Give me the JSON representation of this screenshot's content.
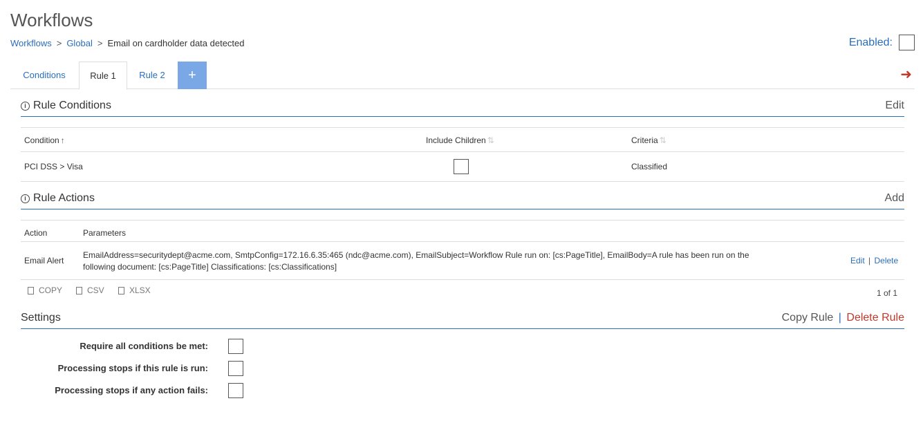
{
  "page": {
    "title": "Workflows"
  },
  "breadcrumb": {
    "items": [
      "Workflows",
      "Global",
      "Email on cardholder data detected"
    ],
    "separator": ">"
  },
  "enabled": {
    "label": "Enabled:",
    "checked": false
  },
  "tabs": {
    "items": [
      "Conditions",
      "Rule 1",
      "Rule 2"
    ],
    "active": "Rule 1",
    "add_label": "+"
  },
  "rule_conditions": {
    "title": "Rule Conditions",
    "action": "Edit",
    "columns": [
      "Condition",
      "Include Children",
      "Criteria"
    ],
    "rows": [
      {
        "condition": "PCI DSS > Visa",
        "include_children": false,
        "criteria": "Classified"
      }
    ]
  },
  "rule_actions": {
    "title": "Rule Actions",
    "action": "Add",
    "columns": [
      "Action",
      "Parameters"
    ],
    "rows": [
      {
        "action": "Email Alert",
        "parameters_line1": "EmailAddress=securitydept@acme.com, SmtpConfig=172.16.6.35:465 (ndc@acme.com), EmailSubject=Workflow Rule run on: [cs:PageTitle], EmailBody=A rule has been run on the",
        "parameters_line2": "following document: [cs:PageTitle] Classifications: [cs:Classifications]",
        "edit": "Edit",
        "delete": "Delete",
        "separator": "|"
      }
    ],
    "export": [
      "COPY",
      "CSV",
      "XLSX"
    ],
    "pager": "1 of 1"
  },
  "settings": {
    "title": "Settings",
    "copy_rule": "Copy Rule",
    "delete_rule": "Delete Rule",
    "separator": "|",
    "options": [
      {
        "label": "Require all conditions be met:",
        "checked": false
      },
      {
        "label": "Processing stops if this rule is run:",
        "checked": false
      },
      {
        "label": "Processing stops if any action fails:",
        "checked": false
      }
    ]
  },
  "colors": {
    "link": "#2a6ebb",
    "danger": "#c0392b",
    "tab_add": "#7aa7e6"
  },
  "icons": {
    "next": "arrow-right-icon",
    "info": "info-icon"
  }
}
